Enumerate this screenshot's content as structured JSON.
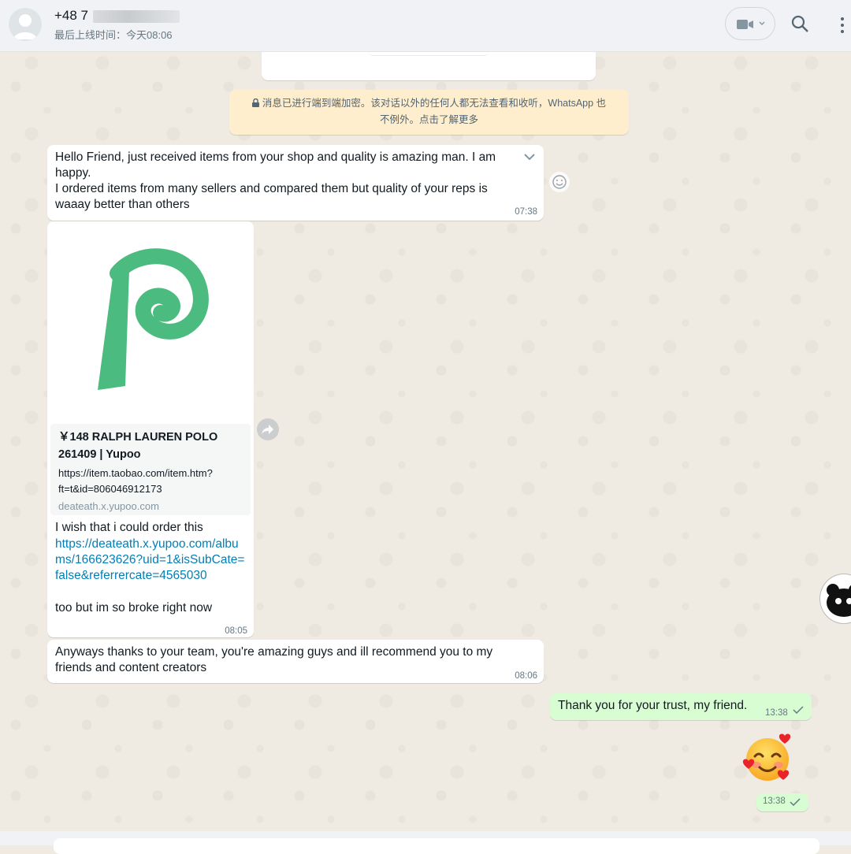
{
  "header": {
    "contact_name": "+48 7",
    "last_seen": "最后上线时间：今天08:06"
  },
  "system": {
    "encryption_notice_line1": "消息已进行端到端加密。该对话以外的任何人都无法查看和收听，WhatsApp 也",
    "encryption_notice_line2": "不例外。点击了解更多"
  },
  "messages": [
    {
      "direction": "in",
      "text": "Hello Friend, just received items from your shop and quality is amazing man. I am\nhappy.\nI ordered items from many sellers and compared them but quality of your reps is\nwaaay better than others",
      "time": "07:38"
    },
    {
      "direction": "in",
      "link_preview": {
        "title": "￥148 RALPH LAUREN POLO 261409 | Yupoo",
        "url": "https://item.taobao.com/item.htm?ft=t&id=806046912173",
        "domain": "deateath.x.yupoo.com"
      },
      "text_before": "I wish that i could order this",
      "link": "https://deateath.x.yupoo.com/albums/166623626?uid=1&isSubCate=false&referrercate=4565030",
      "text_after": "too but im so broke right now",
      "time": "08:05"
    },
    {
      "direction": "in",
      "text": "Anyways thanks to your team, you're amazing guys and ill recommend you to my\nfriends and content creators",
      "time": "08:06"
    },
    {
      "direction": "out",
      "text": "Thank you for your trust, my friend.",
      "time": "13:38"
    },
    {
      "direction": "out",
      "sticker": "smiling-face-with-hearts",
      "time": "13:38"
    }
  ],
  "colors": {
    "chat_bg": "#efeae2",
    "incoming_bubble": "#ffffff",
    "outgoing_bubble": "#d9fdd3",
    "link": "#027eb5",
    "yupoo_logo": "#4cbb7f",
    "notice_bg": "#ffeecd"
  },
  "icons": [
    "avatar-icon",
    "video-call-icon",
    "search-icon",
    "menu-icon",
    "lock-icon",
    "chevron-down-icon",
    "emoji-icon",
    "forward-icon",
    "check-icon"
  ]
}
